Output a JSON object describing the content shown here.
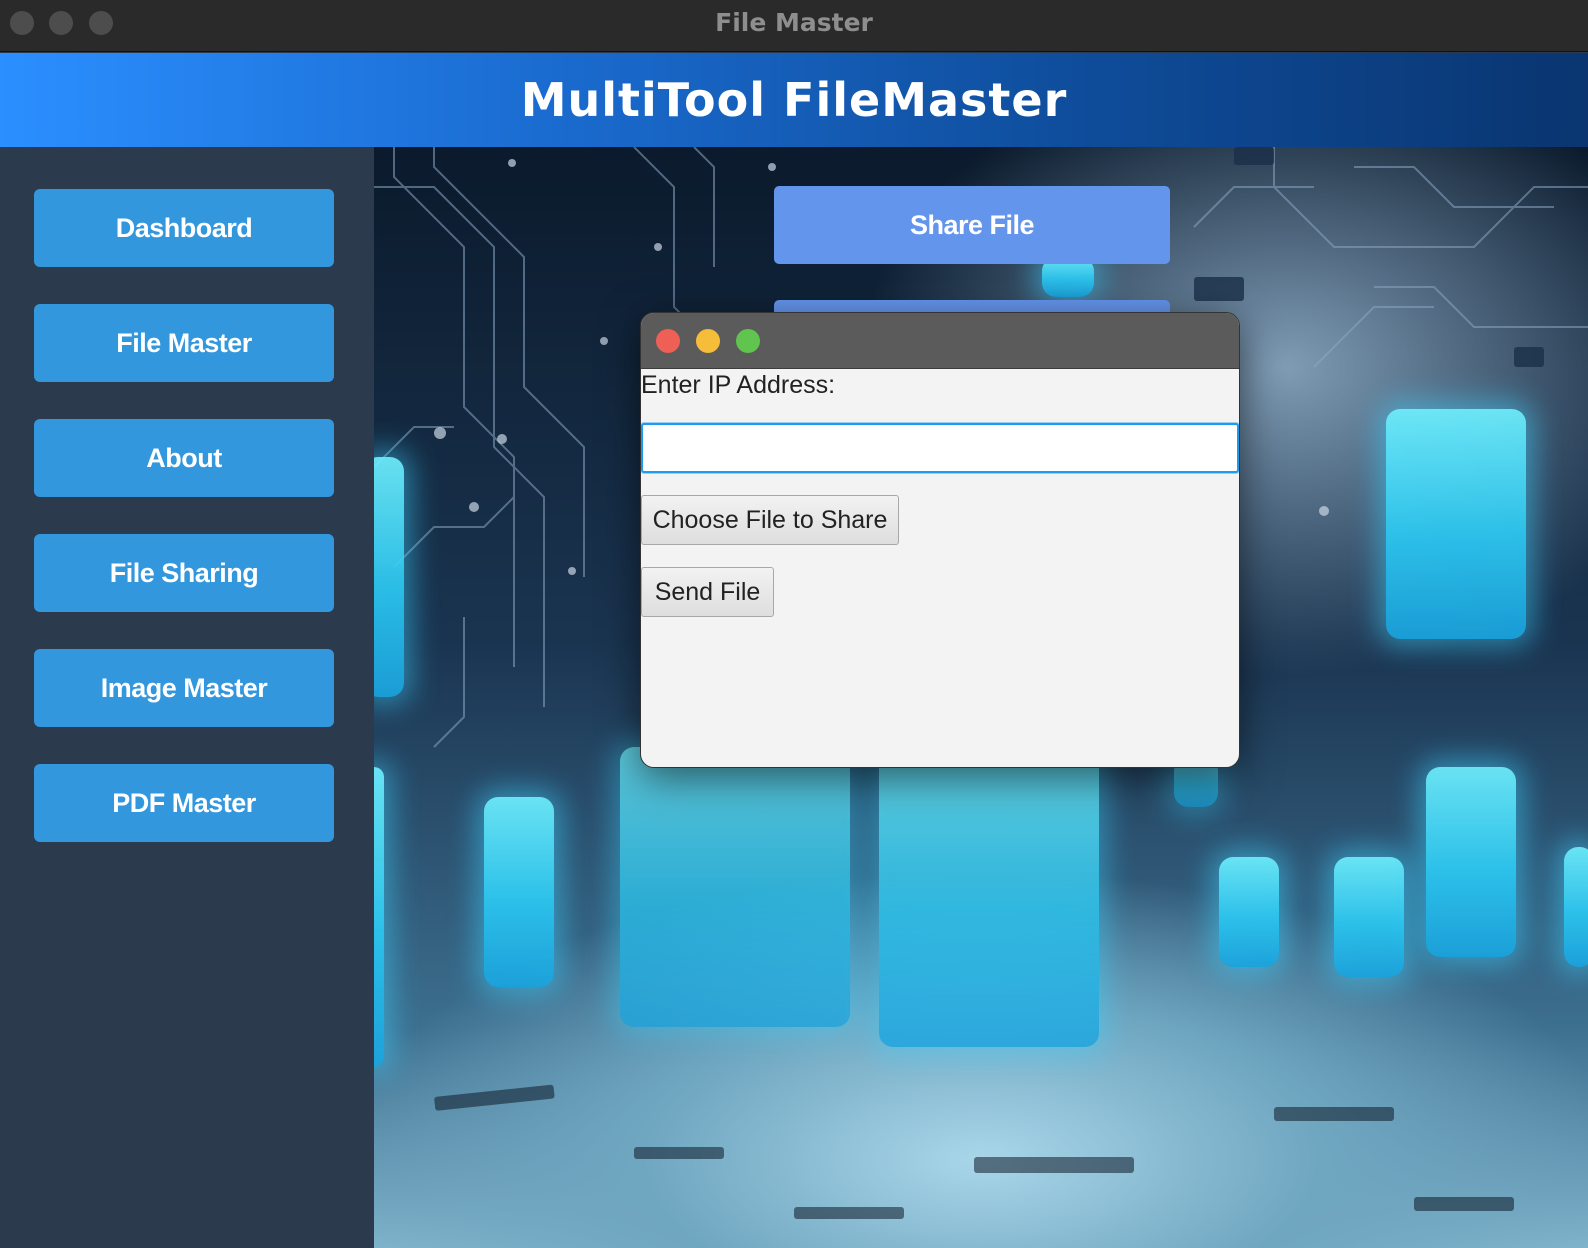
{
  "window": {
    "title": "File Master"
  },
  "header": {
    "title": "MultiTool FileMaster"
  },
  "sidebar": {
    "items": [
      {
        "label": "Dashboard"
      },
      {
        "label": "File Master"
      },
      {
        "label": "About"
      },
      {
        "label": "File Sharing"
      },
      {
        "label": "Image Master"
      },
      {
        "label": "PDF Master"
      }
    ]
  },
  "main": {
    "share_button": "Share File"
  },
  "dialog": {
    "ip_label": "Enter IP Address:",
    "ip_value": "",
    "choose_button": "Choose File to Share",
    "send_button": "Send File"
  },
  "colors": {
    "sidebar_bg": "#2b3a4d",
    "nav_button": "#3397de",
    "share_button": "#6495ed",
    "header_gradient_start": "#2b8fff",
    "header_gradient_end": "#0a3570"
  }
}
